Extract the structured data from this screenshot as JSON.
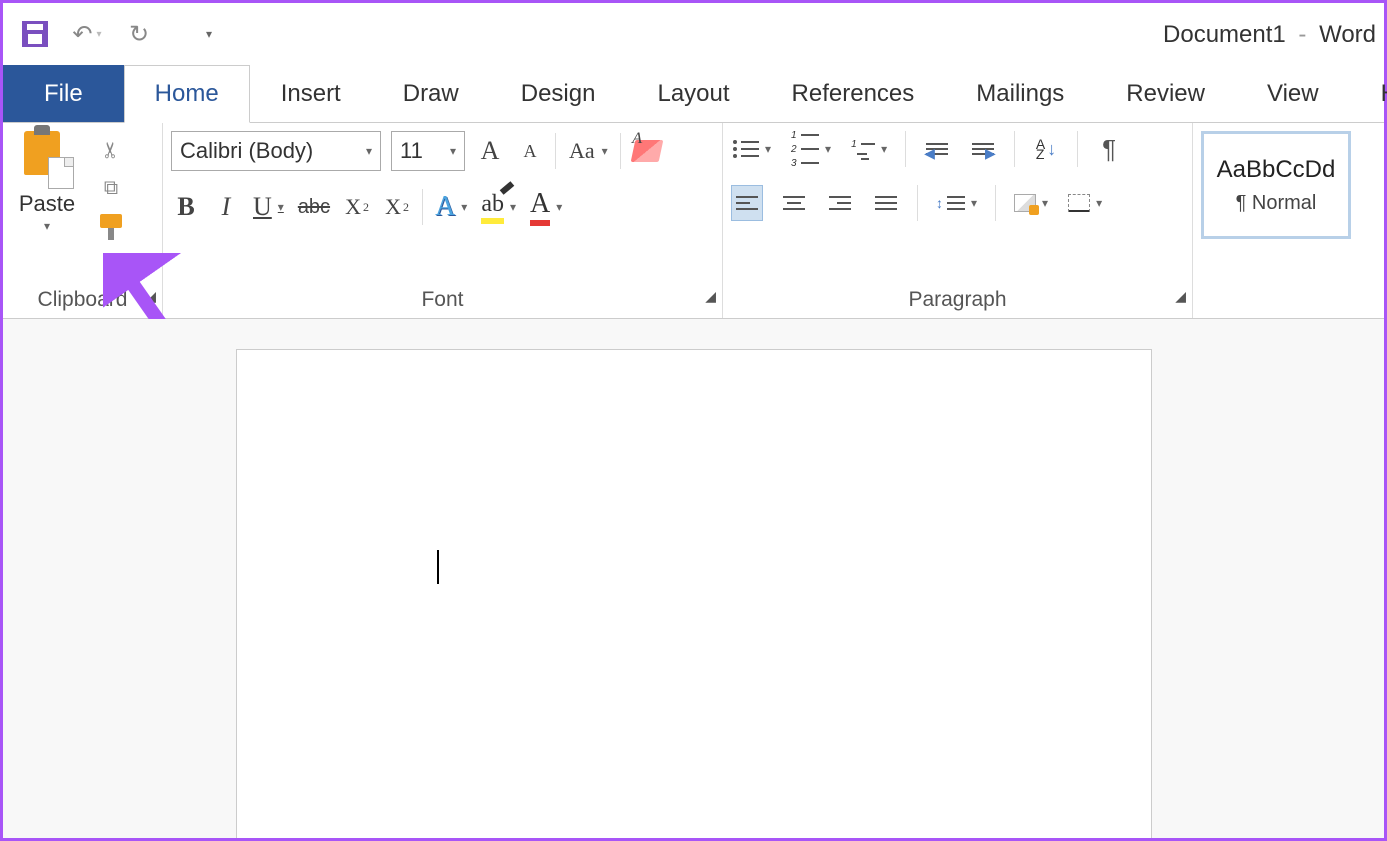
{
  "title": {
    "doc": "Document1",
    "app": "Word"
  },
  "tabs": {
    "file": "File",
    "home": "Home",
    "insert": "Insert",
    "draw": "Draw",
    "design": "Design",
    "layout": "Layout",
    "references": "References",
    "mailings": "Mailings",
    "review": "Review",
    "view": "View",
    "help": "Help"
  },
  "clipboard": {
    "paste": "Paste",
    "label": "Clipboard"
  },
  "font": {
    "name": "Calibri (Body)",
    "size": "11",
    "change_case": "Aa",
    "strike": "abc",
    "label": "Font"
  },
  "paragraph": {
    "label": "Paragraph"
  },
  "styles": {
    "preview": "AaBbCcDd",
    "name": "Normal",
    "pilcrow": "¶"
  }
}
